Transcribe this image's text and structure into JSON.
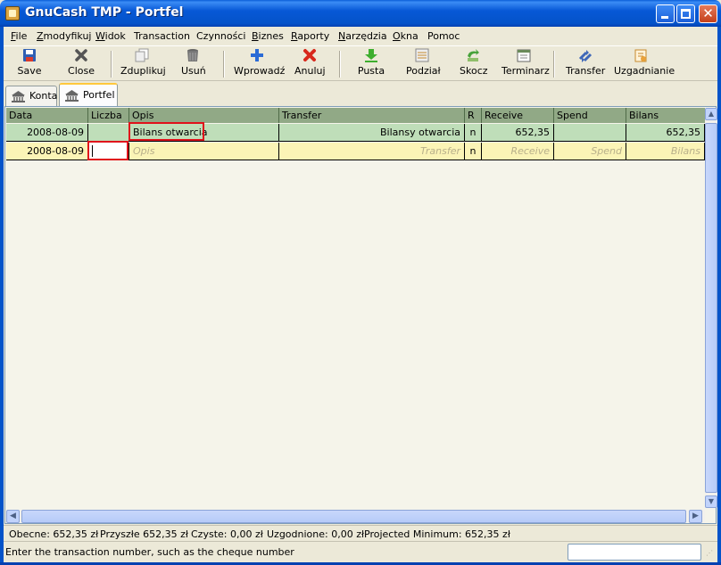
{
  "window": {
    "title": "GnuCash TMP - Portfel"
  },
  "menu": [
    {
      "label": "File",
      "key": "F",
      "rest": "ile"
    },
    {
      "label": "Zmodyfikuj",
      "key": "Z",
      "rest": "modyfikuj"
    },
    {
      "label": "Widok",
      "key": "W",
      "rest": "idok"
    },
    {
      "label": "Transaction",
      "key": "",
      "rest": "Transaction"
    },
    {
      "label": "Czynności",
      "key": "",
      "rest": "Czynności"
    },
    {
      "label": "Biznes",
      "key": "B",
      "rest": "iznes"
    },
    {
      "label": "Raporty",
      "key": "R",
      "rest": "aporty"
    },
    {
      "label": "Narzędzia",
      "key": "N",
      "rest": "arzędzia"
    },
    {
      "label": "Okna",
      "key": "O",
      "rest": "kna"
    },
    {
      "label": "Pomoc",
      "key": "",
      "rest": "Pomoc"
    }
  ],
  "toolbar": {
    "save": "Save",
    "close": "Close",
    "duplicate": "Zduplikuj",
    "delete": "Usuń",
    "enter": "Wprowadź",
    "cancel": "Anuluj",
    "blank": "Pusta",
    "split": "Podział",
    "jump": "Skocz",
    "schedule": "Terminarz",
    "transfer": "Transfer",
    "reconcile": "Uzgadnianie"
  },
  "tabs": [
    {
      "label": "Konta",
      "icon": "bank-icon",
      "active": false
    },
    {
      "label": "Portfel",
      "icon": "bank-icon",
      "active": true
    }
  ],
  "register": {
    "columns": [
      "Data",
      "Liczba",
      "Opis",
      "Transfer",
      "R",
      "Receive",
      "Spend",
      "Bilans"
    ],
    "rows": [
      {
        "date": "2008-08-09",
        "num": "",
        "description": "Bilans otwarcia",
        "transfer": "Bilansy otwarcia",
        "r": "n",
        "receive": "652,35",
        "spend": "",
        "balance": "652,35"
      }
    ],
    "blank_row": {
      "date": "2008-08-09",
      "num": "",
      "description": "Opis",
      "transfer": "Transfer",
      "r": "n",
      "receive": "Receive",
      "spend": "Spend",
      "balance": "Bilans"
    }
  },
  "summary": {
    "present": "Obecne: 652,35 zł",
    "future": "Przyszłe 652,35 zł",
    "cleared": "Czyste: 0,00 zł",
    "reconciled": "Uzgodnione: 0,00 zł",
    "projected": "Projected Minimum: 652,35 zł"
  },
  "status": {
    "message": "Enter the transaction number, such as the cheque number"
  },
  "colors": {
    "titlebar": "#0453c9",
    "header": "#91a986",
    "row_committed": "#bfdeb9",
    "row_blank": "#fbf4b6",
    "highlight": "#e0121b"
  }
}
